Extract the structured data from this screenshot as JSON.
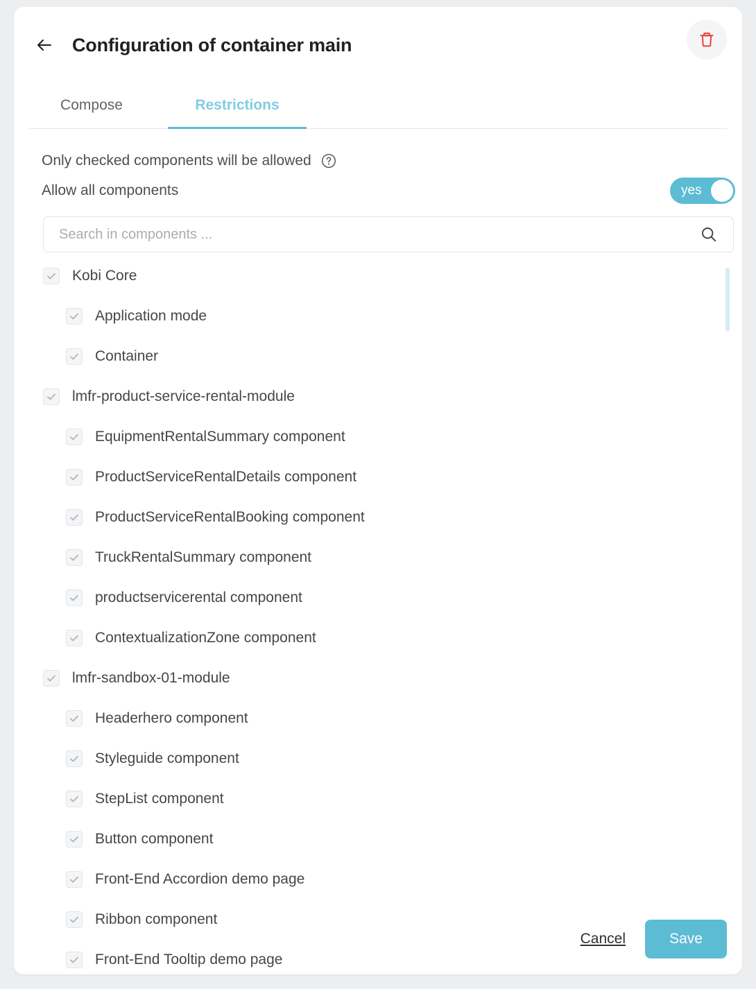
{
  "header": {
    "title": "Configuration of container main",
    "back_icon": "arrow-left-icon",
    "delete_icon": "trash-icon",
    "delete_color": "#e8443c"
  },
  "tabs": [
    {
      "id": "compose",
      "label": "Compose",
      "active": false
    },
    {
      "id": "restrictions",
      "label": "Restrictions",
      "active": true
    }
  ],
  "accent_color": "#5bbcd4",
  "restrictions": {
    "info_text": "Only checked components will be allowed",
    "help_icon": "question-circle-icon",
    "allow_all_label": "Allow all components",
    "toggle": {
      "value": "yes",
      "state": "on"
    },
    "search": {
      "placeholder": "Search in components ...",
      "value": "",
      "icon": "search-icon"
    },
    "tree": [
      {
        "label": "Kobi Core",
        "checked": true,
        "children": [
          {
            "label": "Application mode",
            "checked": true
          },
          {
            "label": "Container",
            "checked": true
          }
        ]
      },
      {
        "label": "lmfr-product-service-rental-module",
        "checked": true,
        "children": [
          {
            "label": "EquipmentRentalSummary component",
            "checked": true
          },
          {
            "label": "ProductServiceRentalDetails component",
            "checked": true
          },
          {
            "label": "ProductServiceRentalBooking component",
            "checked": true
          },
          {
            "label": "TruckRentalSummary component",
            "checked": true
          },
          {
            "label": "productservicerental component",
            "checked": true
          },
          {
            "label": "ContextualizationZone component",
            "checked": true
          }
        ]
      },
      {
        "label": "lmfr-sandbox-01-module",
        "checked": true,
        "children": [
          {
            "label": "Headerhero component",
            "checked": true
          },
          {
            "label": "Styleguide component",
            "checked": true
          },
          {
            "label": "StepList component",
            "checked": true
          },
          {
            "label": "Button component",
            "checked": true
          },
          {
            "label": "Front-End Accordion demo page",
            "checked": true
          },
          {
            "label": "Ribbon component",
            "checked": true
          },
          {
            "label": "Front-End Tooltip demo page",
            "checked": true
          }
        ]
      }
    ]
  },
  "footer": {
    "cancel_label": "Cancel",
    "save_label": "Save"
  }
}
